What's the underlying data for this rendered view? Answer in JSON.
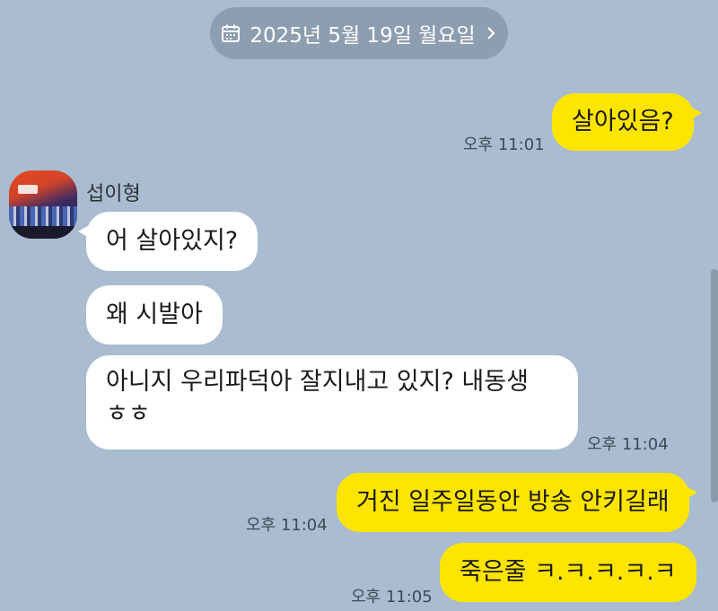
{
  "date_divider": {
    "label": "2025년 5월 19일 월요일",
    "icon": "calendar-icon",
    "chevron": "chevron-right-icon"
  },
  "sender": {
    "name": "섭이형",
    "avatar": "avatar-image"
  },
  "messages": [
    {
      "side": "mine",
      "text": "살아있음?",
      "time": "오후 11:01"
    },
    {
      "side": "theirs",
      "text": "어 살아있지?"
    },
    {
      "side": "theirs",
      "text": "왜 시발아"
    },
    {
      "side": "theirs",
      "lines": [
        "아니지 우리파덕아 잘지내고 있지? 내동생",
        "ㅎㅎ"
      ],
      "time": "오후 11:04"
    },
    {
      "side": "mine",
      "text": "거진 일주일동안 방송 안키길래",
      "time": "오후 11:04"
    },
    {
      "side": "mine",
      "text": "죽은줄 ㅋ.ㅋ.ㅋ.ㅋ.ㅋ",
      "time": "오후 11:05"
    }
  ],
  "colors": {
    "background": "#a9bcd0",
    "my_bubble": "#fee500",
    "their_bubble": "#ffffff",
    "date_pill": "#8d9eb0"
  }
}
